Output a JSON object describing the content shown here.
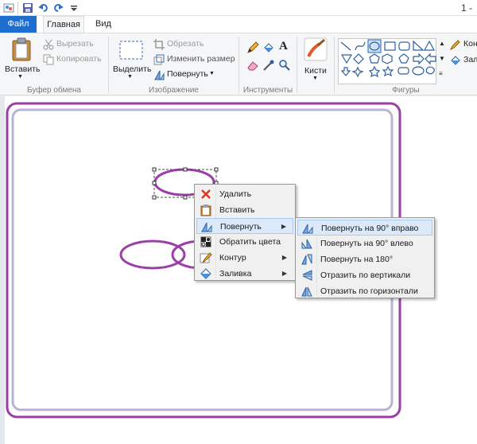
{
  "titlebar": {
    "title_fragment": "1 -"
  },
  "tabs": [
    {
      "label": "Файл"
    },
    {
      "label": "Главная"
    },
    {
      "label": "Вид"
    }
  ],
  "ribbon": {
    "clipboard": {
      "paste_label": "Вставить",
      "cut_label": "Вырезать",
      "copy_label": "Копировать",
      "group_label": "Буфер обмена"
    },
    "image": {
      "select_label": "Выделить",
      "crop_label": "Обрезать",
      "resize_label": "Изменить размер",
      "rotate_label": "Повернуть",
      "group_label": "Изображение"
    },
    "tools": {
      "group_label": "Инструменты"
    },
    "brushes": {
      "label": "Кисти"
    },
    "shapes": {
      "group_label": "Фигуры",
      "outline_label": "Кон",
      "fill_label": "Зал"
    }
  },
  "context_menu": {
    "items": [
      {
        "label": "Удалить",
        "icon": "delete-icon"
      },
      {
        "label": "Вставить",
        "icon": "paste-icon"
      },
      {
        "label": "Повернуть",
        "icon": "rotate-icon",
        "has_submenu": true,
        "highlighted": true
      },
      {
        "label": "Обратить цвета",
        "icon": "invert-colors-icon"
      },
      {
        "label": "Контур",
        "icon": "outline-icon",
        "has_submenu": true
      },
      {
        "label": "Заливка",
        "icon": "fill-icon",
        "has_submenu": true
      }
    ]
  },
  "rotate_submenu": {
    "items": [
      {
        "label": "Повернуть на 90° вправо",
        "icon": "rotate-right-icon",
        "highlighted": true
      },
      {
        "label": "Повернуть на 90° влево",
        "icon": "rotate-left-icon"
      },
      {
        "label": "Повернуть на 180°",
        "icon": "rotate-180-icon"
      },
      {
        "label": "Отразить по вертикали",
        "icon": "flip-vertical-icon"
      },
      {
        "label": "Отразить по горизонтали",
        "icon": "flip-horizontal-icon"
      }
    ]
  },
  "colors": {
    "file_tab": "#1e6ed0",
    "shape_stroke": "#9a3fa8",
    "frame_inner": "#b9b2d6",
    "menu_highlight": "#dbe9f9"
  }
}
